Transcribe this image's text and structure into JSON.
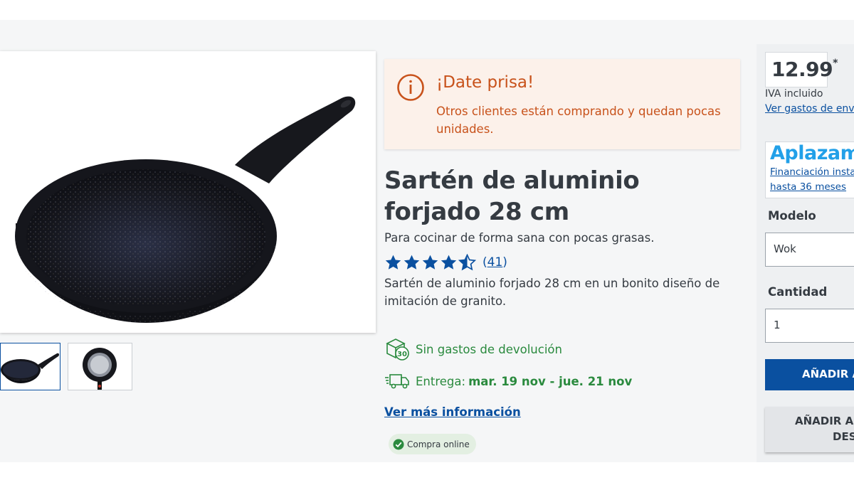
{
  "alert": {
    "title": "¡Date prisa!",
    "text": "Otros clientes están comprando y quedan pocas unidades."
  },
  "product": {
    "title": "Sartén de aluminio forjado 28 cm",
    "subtitle": "Para cocinar de forma sana con pocas grasas.",
    "rating": 4.5,
    "rating_max": 5,
    "rating_count_open": "(",
    "rating_count": "41",
    "rating_count_close": ")",
    "description": "Sartén de aluminio forjado 28 cm en un bonito diseño de imitación de granito."
  },
  "benefits": {
    "returns": "Sin gastos de devolución",
    "returns_icon_text": "30",
    "delivery_label": "Entrega:",
    "delivery_dates": "mar. 19 nov - jue. 21 nov"
  },
  "links": {
    "more_info": "Ver más información"
  },
  "badge": {
    "online": "Compra online"
  },
  "purchase": {
    "price": "12.99",
    "price_suffix": "*",
    "vat": "IVA incluido",
    "shipping_link": "Ver gastos de envío",
    "aplazame_logo": "Aplazam",
    "aplazame_line1": "Financiación instan",
    "aplazame_line2": "hasta 36 meses",
    "model_label": "Modelo",
    "model_value": "Wok",
    "quantity_label": "Cantidad",
    "quantity_value": "1",
    "add_to_cart": "AÑADIR A",
    "wishlist_line1": "AÑADIR A M",
    "wishlist_line2": "DESE"
  },
  "colors": {
    "primary_blue": "#0a50a0",
    "alert_orange": "#c8521b",
    "success_green": "#2a8a3e",
    "star_blue": "#0a50a0"
  }
}
